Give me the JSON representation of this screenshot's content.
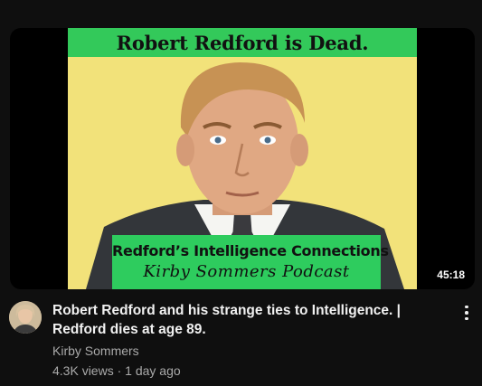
{
  "video": {
    "thumbnail": {
      "top_banner": "Robert Redford is Dead.",
      "bottom_banner_line1": "Redford’s Intelligence Connections",
      "bottom_banner_line2": "Kirby Sommers Podcast"
    },
    "duration": "45:18",
    "title": "Robert Redford and his strange ties to Intelligence. | Redford dies at age 89.",
    "channel": "Kirby Sommers",
    "views": "4.3K views",
    "separator": "·",
    "age": "1 day ago",
    "menu_icon": "more-vert-icon"
  },
  "colors": {
    "background": "#0f0f0f",
    "banner_green": "#33c95a",
    "thumb_bg": "#f2e27a",
    "secondary_text": "#aaaaaa"
  }
}
